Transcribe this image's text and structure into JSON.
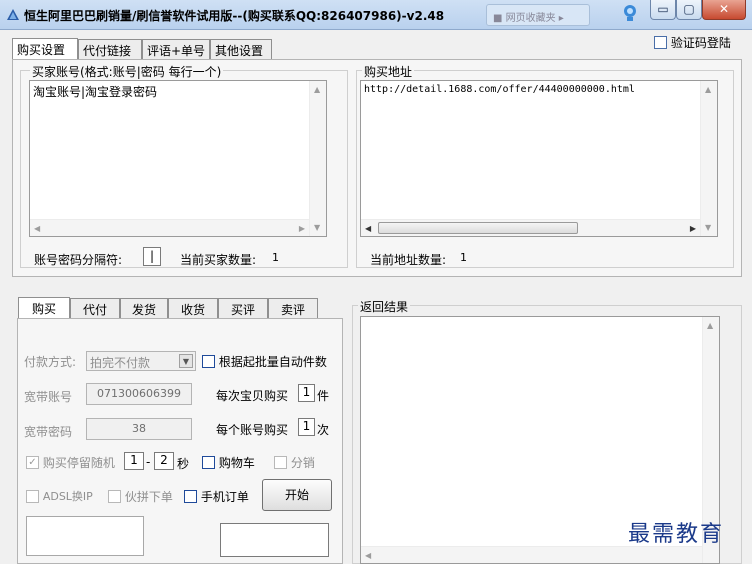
{
  "window": {
    "title": "恒生阿里巴巴刷销量/刷信誉软件试用版--(购买联系QQ:826407986)-v2.48",
    "ghost_tab": "■ 网页收藏夹 ▸",
    "min_glyph": "▭",
    "max_glyph": "▢",
    "close_glyph": "✕"
  },
  "top_tabs": [
    "购买设置",
    "代付链接",
    "评语+单号",
    "其他设置"
  ],
  "captcha_login": "验证码登陆",
  "buyer": {
    "group_label": "买家账号(格式:账号|密码 每行一个)",
    "content": "淘宝账号|淘宝登录密码",
    "separator_label": "账号密码分隔符:",
    "separator_value": "|",
    "count_label": "当前买家数量:",
    "count": "1"
  },
  "address": {
    "group_label": "购买地址",
    "content": "http://detail.1688.com/offer/44400000000.html",
    "count_label": "当前地址数量:",
    "count": "1"
  },
  "sub_tabs": [
    "购买",
    "代付",
    "发货",
    "收货",
    "买评",
    "卖评"
  ],
  "purchase": {
    "payment_label": "付款方式:",
    "payment_value": "拍完不付款",
    "auto_qty_label": "根据起批量自动件数",
    "broadband_account_label": "宽带账号",
    "broadband_account_value": "071300606399",
    "per_item_label": "每次宝贝购买",
    "per_item_value": "1",
    "per_item_unit": "件",
    "broadband_password_label": "宽带密码",
    "broadband_password_value": "38",
    "per_account_label": "每个账号购买",
    "per_account_value": "1",
    "per_account_unit": "次",
    "random_pause_label": "购买停留随机",
    "pause_min": "1",
    "pause_dash": "-",
    "pause_max": "2",
    "pause_unit": "秒",
    "cart_label": "购物车",
    "split_label": "分销",
    "adsl_label": "ADSL换IP",
    "group_buy_label": "伙拼下单",
    "mobile_order_label": "手机订单",
    "start_label": "开始"
  },
  "results": {
    "group_label": "返回结果"
  },
  "watermark": "最需教育",
  "colors": {
    "titlebar": "#c3d7f0",
    "close": "#c74a30",
    "watermark": "#1b3a8a"
  }
}
